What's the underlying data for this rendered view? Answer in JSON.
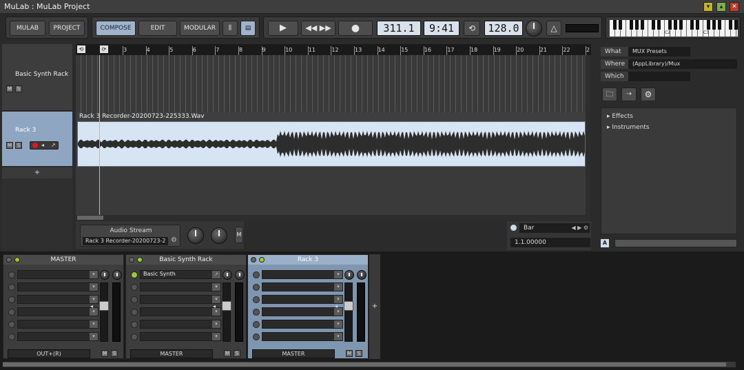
{
  "window": {
    "title": "MuLab : MuLab Project"
  },
  "toolbar": {
    "mulab": "MULAB",
    "project": "PROJECT",
    "compose": "COMPOSE",
    "edit": "EDIT",
    "modular": "MODULAR",
    "position": "311.1",
    "time": "9:41",
    "tempo": "128.0"
  },
  "keyboard": {
    "c2": "C2",
    "c3": "C3"
  },
  "tracks": [
    {
      "name": "Basic Synth Rack",
      "m": "M",
      "s": "S"
    },
    {
      "name": "Rack 3",
      "m": "M",
      "s": "S"
    }
  ],
  "add_track": "+",
  "ruler": [
    "3",
    "4",
    "5",
    "6",
    "7",
    "8",
    "9",
    "10",
    "11",
    "12",
    "13",
    "14",
    "15",
    "16",
    "17",
    "18",
    "19",
    "20",
    "21",
    "22",
    "2"
  ],
  "clip": {
    "name": "Rack 3 Recorder-20200723-225333.Wav"
  },
  "audio_stream": {
    "title": "Audio Stream",
    "file": "Rack 3 Recorder-20200723-2",
    "m": "M"
  },
  "snap": {
    "unit": "Bar",
    "position": "1.1.00000"
  },
  "browser": {
    "what_label": "What",
    "what_value": "MUX Presets",
    "where_label": "Where",
    "where_value": "(AppLibrary)/Mux",
    "which_label": "Which",
    "which_value": "",
    "tree": [
      "Effects",
      "Instruments"
    ],
    "a_btn": "A"
  },
  "mixer": {
    "strips": [
      {
        "title": "MASTER",
        "output": "OUT+(R)",
        "inserts": [
          ""
        ],
        "m": "M",
        "s": "S"
      },
      {
        "title": "Basic Synth Rack",
        "output": "MASTER",
        "inserts": [
          "Basic Synth"
        ],
        "m": "M",
        "s": "S"
      },
      {
        "title": "Rack 3",
        "output": "MASTER",
        "inserts": [
          ""
        ],
        "m": "M",
        "s": "S"
      }
    ],
    "add": "+"
  },
  "colors": {
    "accent": "#9fb4cc",
    "selected_track": "#8ea6c2",
    "waveform_bg": "#d6e4f4",
    "record": "#e01818"
  }
}
